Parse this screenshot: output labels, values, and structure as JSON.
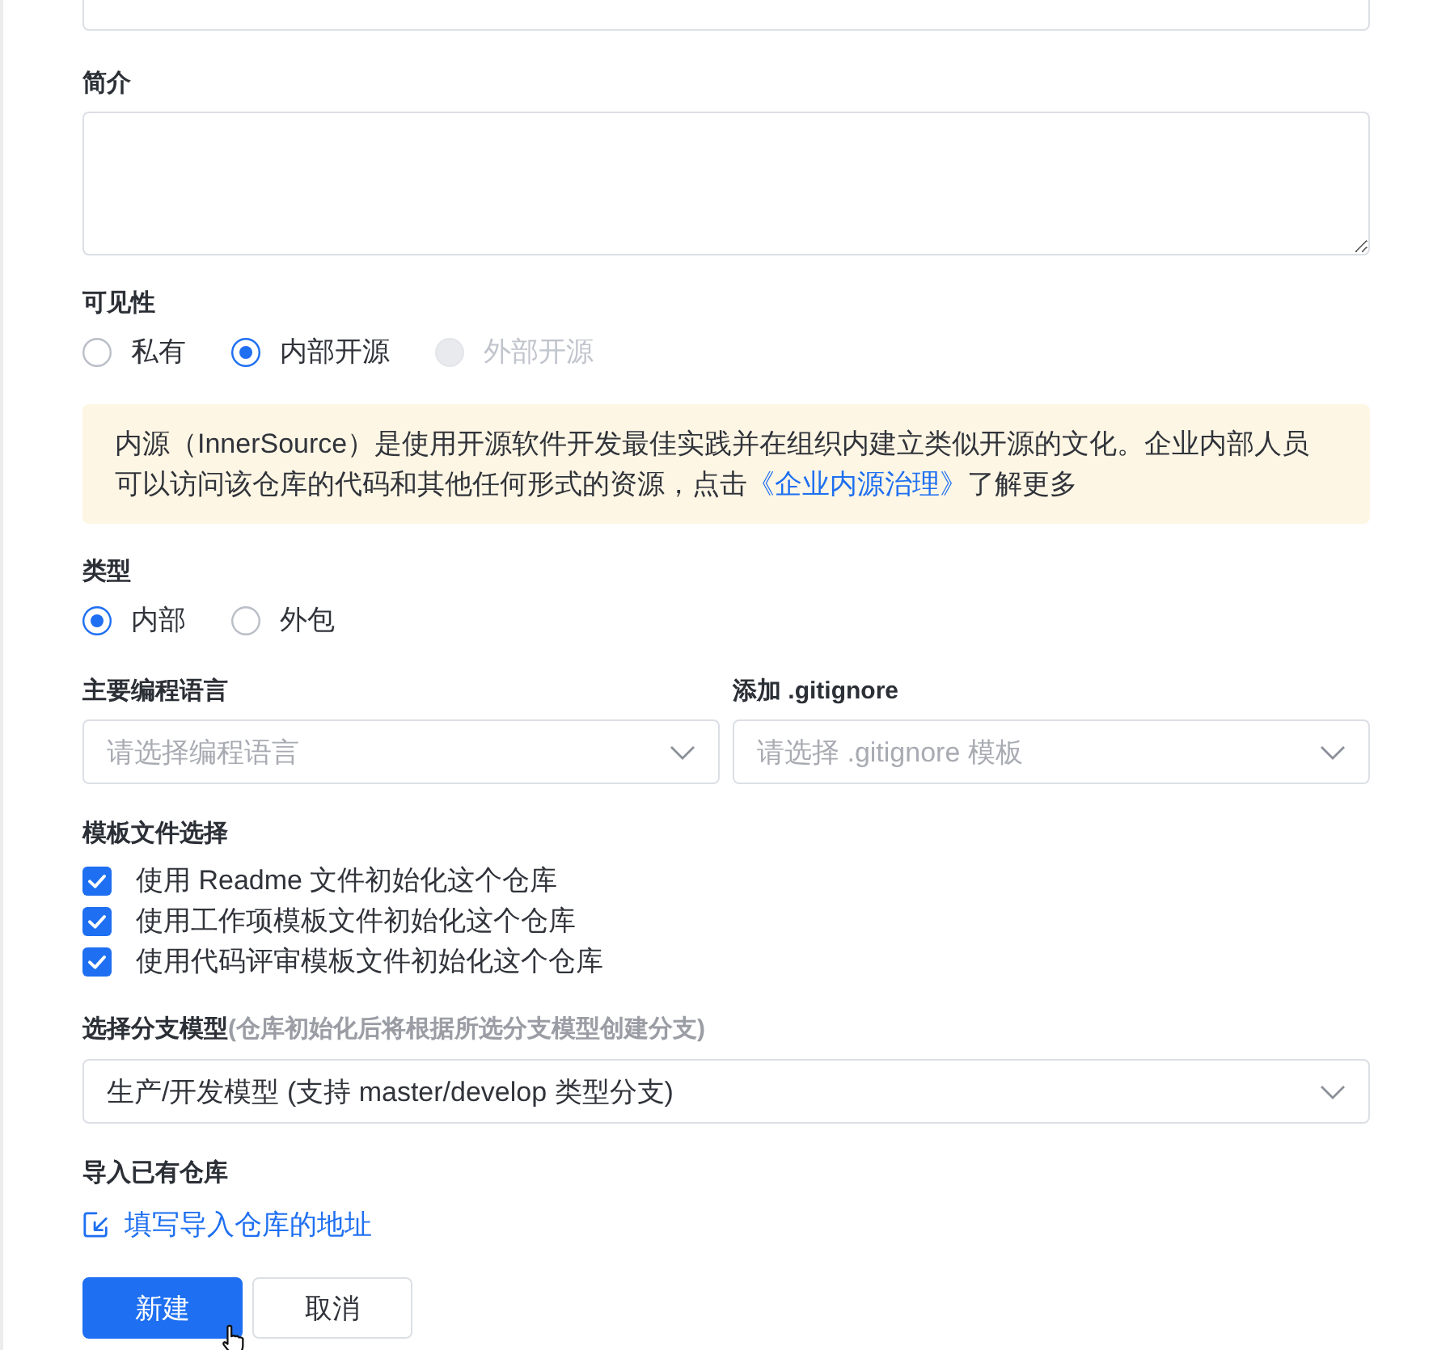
{
  "description": {
    "label": "简介"
  },
  "visibility": {
    "label": "可见性",
    "options": [
      {
        "label": "私有",
        "selected": false,
        "disabled": false
      },
      {
        "label": "内部开源",
        "selected": true,
        "disabled": false
      },
      {
        "label": "外部开源",
        "selected": false,
        "disabled": true
      }
    ]
  },
  "notice": {
    "text": "内源（InnerSource）是使用开源软件开发最佳实践并在组织内建立类似开源的文化。企业内部人员可以访问该仓库的代码和其他任何形式的资源，点击",
    "link": "《企业内源治理》",
    "suffix": "了解更多"
  },
  "type": {
    "label": "类型",
    "options": [
      {
        "label": "内部",
        "selected": true,
        "disabled": false
      },
      {
        "label": "外包",
        "selected": false,
        "disabled": false
      }
    ]
  },
  "language": {
    "label": "主要编程语言",
    "placeholder": "请选择编程语言"
  },
  "gitignore": {
    "label": "添加 .gitignore",
    "placeholder": "请选择 .gitignore 模板"
  },
  "templates": {
    "label": "模板文件选择",
    "items": [
      {
        "label": "使用 Readme 文件初始化这个仓库",
        "checked": true
      },
      {
        "label": "使用工作项模板文件初始化这个仓库",
        "checked": true
      },
      {
        "label": "使用代码评审模板文件初始化这个仓库",
        "checked": true
      }
    ]
  },
  "branch_model": {
    "label": "选择分支模型",
    "hint": "(仓库初始化后将根据所选分支模型创建分支)",
    "value": "生产/开发模型 (支持 master/develop 类型分支)"
  },
  "import": {
    "label": "导入已有仓库",
    "link": "填写导入仓库的地址"
  },
  "buttons": [
    {
      "label": "新建",
      "kind": "primary"
    },
    {
      "label": "取消",
      "kind": "default"
    }
  ]
}
